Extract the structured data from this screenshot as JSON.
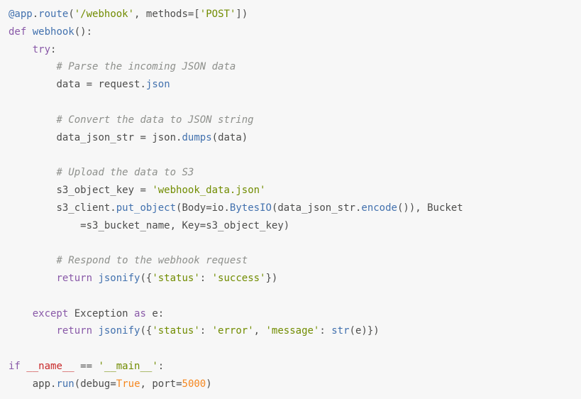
{
  "code": {
    "l1": {
      "decor_at": "@app",
      "decor_dot1": ".",
      "decor_route": "route",
      "decor_open": "(",
      "s_webhook": "'/webhook'",
      "comma1": ", ",
      "kw_methods": "methods",
      "eq1": "=",
      "lb": "[",
      "s_post": "'POST'",
      "rb": "]",
      "close": ")"
    },
    "l2": {
      "def": "def",
      "sp": " ",
      "name": "webhook",
      "parens": "():"
    },
    "l3": {
      "try": "try",
      "colon": ":"
    },
    "l4": {
      "comment": "# Parse the incoming JSON data"
    },
    "l5": {
      "data": "data ",
      "eq": "=",
      "sp": " request",
      "dot": ".",
      "json": "json"
    },
    "l6_blank": "",
    "l7": {
      "comment": "# Convert the data to JSON string"
    },
    "l8": {
      "var": "data_json_str ",
      "eq": "=",
      "sp": " json",
      "dot": ".",
      "dumps": "dumps",
      "open": "(",
      "arg": "data",
      "close": ")"
    },
    "l9_blank": "",
    "l10": {
      "comment": "# Upload the data to S3"
    },
    "l11": {
      "var": "s3_object_key ",
      "eq": "=",
      "sp": " ",
      "str": "'webhook_data.json'"
    },
    "l12": {
      "client": "s3_client",
      "dot": ".",
      "put": "put_object",
      "open": "(",
      "body_kw": "Body",
      "eq1": "=",
      "io": "io",
      "dot2": ".",
      "bytesio": "BytesIO",
      "open2": "(",
      "djs": "data_json_str",
      "dot3": ".",
      "encode": "encode",
      "parens3": "()",
      "close2": ")",
      "comma": ", ",
      "bucket_kw": "Bucket"
    },
    "l13": {
      "indent_cont": "            ",
      "eq": "=",
      "bucketname": "s3_bucket_name",
      "comma": ", ",
      "key_kw": "Key",
      "eq2": "=",
      "objkey": "s3_object_key",
      "close": ")"
    },
    "l14_blank": "",
    "l15": {
      "comment": "# Respond to the webhook request"
    },
    "l16": {
      "ret": "return",
      "sp": " ",
      "jsonify": "jsonify",
      "open": "({",
      "k_status": "'status'",
      "colon": ": ",
      "v_success": "'success'",
      "close": "})"
    },
    "l17_blank": "",
    "l18": {
      "except": "except",
      "sp": " ",
      "exc": "Exception",
      "sp2": " ",
      "as": "as",
      "sp3": " ",
      "e": "e",
      "colon": ":"
    },
    "l19": {
      "ret": "return",
      "sp": " ",
      "jsonify": "jsonify",
      "open": "({",
      "k_status": "'status'",
      "c1": ": ",
      "v_error": "'error'",
      "comma": ", ",
      "k_message": "'message'",
      "c2": ": ",
      "str_fn": "str",
      "open2": "(",
      "e": "e",
      "close2": ")",
      "close": "})"
    },
    "l20_blank": "",
    "l21": {
      "if": "if",
      "sp": " ",
      "name": "__name__",
      "sp2": " ",
      "eqeq": "==",
      "sp3": " ",
      "main": "'__main__'",
      "colon": ":"
    },
    "l22": {
      "app": "app",
      "dot": ".",
      "run": "run",
      "open": "(",
      "debug_kw": "debug",
      "eq": "=",
      "true": "True",
      "comma": ", ",
      "port_kw": "port",
      "eq2": "=",
      "port": "5000",
      "close": ")"
    }
  }
}
